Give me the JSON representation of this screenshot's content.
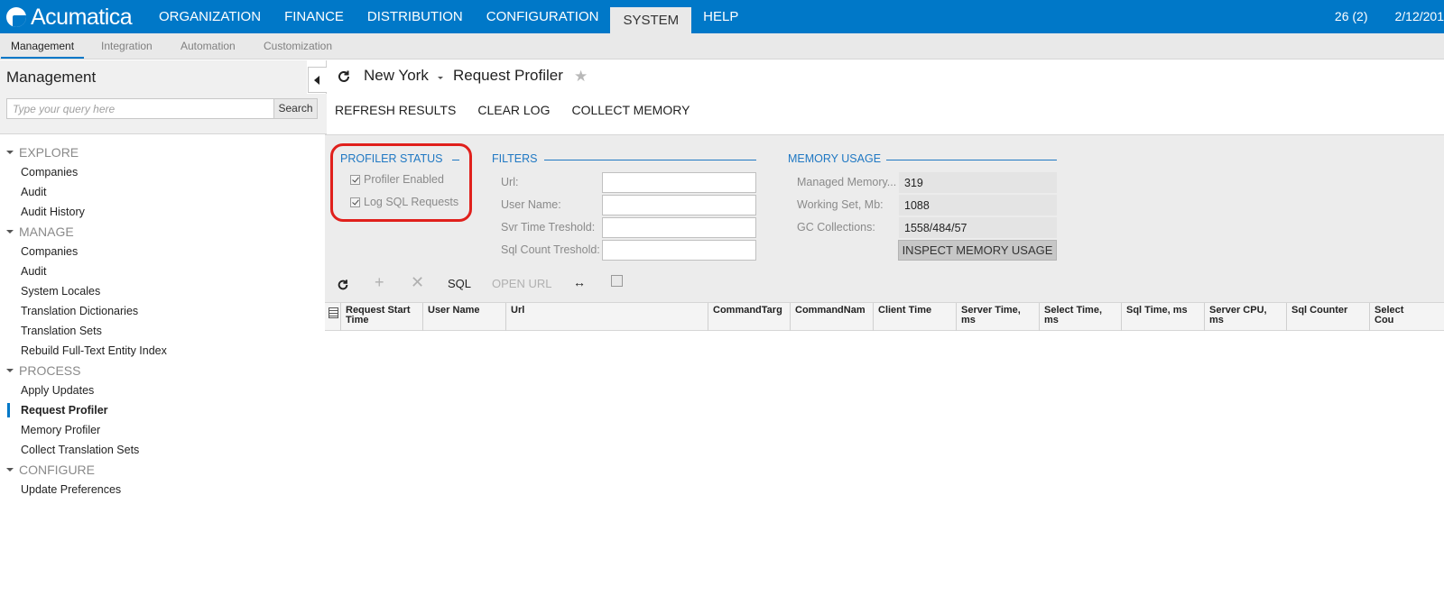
{
  "app": {
    "name": "Acumatica",
    "top_nav": [
      "ORGANIZATION",
      "FINANCE",
      "DISTRIBUTION",
      "CONFIGURATION",
      "SYSTEM",
      "HELP"
    ],
    "active_top_nav": "SYSTEM",
    "notifications": "26 (2)",
    "date": "2/12/201"
  },
  "sub_tabs": [
    "Management",
    "Integration",
    "Automation",
    "Customization"
  ],
  "sidebar": {
    "title": "Management",
    "search_placeholder": "Type your query here",
    "search_button": "Search",
    "groups": [
      {
        "label": "EXPLORE",
        "items": [
          "Companies",
          "Audit",
          "Audit History"
        ]
      },
      {
        "label": "MANAGE",
        "items": [
          "Companies",
          "Audit",
          "System Locales",
          "Translation Dictionaries",
          "Translation Sets",
          "Rebuild Full-Text Entity Index"
        ]
      },
      {
        "label": "PROCESS",
        "items": [
          "Apply Updates",
          "Request Profiler",
          "Memory Profiler",
          "Collect Translation Sets"
        ]
      },
      {
        "label": "CONFIGURE",
        "items": [
          "Update Preferences"
        ]
      }
    ],
    "active_item": "Request Profiler"
  },
  "header": {
    "company": "New York",
    "title": "Request Profiler"
  },
  "toolbar": {
    "refresh_results": "REFRESH RESULTS",
    "clear_log": "CLEAR LOG",
    "collect_memory": "COLLECT MEMORY"
  },
  "profiler_status": {
    "title": "PROFILER STATUS",
    "profiler_enabled": "Profiler Enabled",
    "log_sql": "Log SQL Requests"
  },
  "filters": {
    "title": "FILTERS",
    "url": "Url:",
    "user_name": "User Name:",
    "svr_time": "Svr Time Treshold:",
    "sql_count": "Sql Count Treshold:"
  },
  "memory": {
    "title": "MEMORY USAGE",
    "managed_label": "Managed Memory...",
    "managed_value": "319",
    "working_label": "Working Set, Mb:",
    "working_value": "1088",
    "gc_label": "GC Collections:",
    "gc_value": "1558/484/57",
    "inspect_button": "INSPECT MEMORY USAGE"
  },
  "grid_toolbar": {
    "sql": "SQL",
    "open_url": "OPEN URL"
  },
  "grid": {
    "columns": [
      "Request Start Time",
      "User Name",
      "Url",
      "CommandTarg",
      "CommandNam",
      "Client Time",
      "Server Time, ms",
      "Select Time, ms",
      "Sql Time, ms",
      "Server CPU, ms",
      "Sql Counter",
      "Select Cou"
    ]
  }
}
